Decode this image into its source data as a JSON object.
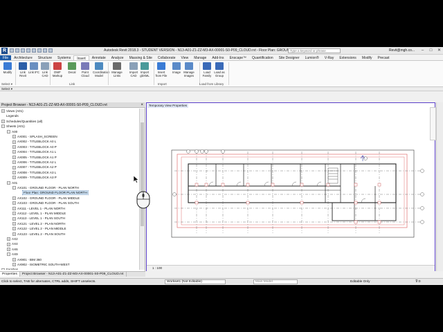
{
  "app": {
    "title": "Autodesk Revit 2018.3 - STUDENT VERSION -    N13-A01-Z1-ZZ-M3-AX-00001-S0-P09_CLOUD.rvt - Floor Plan: GROUND FLOOR PLAN NORTH",
    "search_placeholder": "Type a keyword or phrase",
    "user": "Revit@mgh.co...",
    "window_controls": [
      "–",
      "□",
      "✕"
    ]
  },
  "ribbon_tabs": [
    "File",
    "Architecture",
    "Structure",
    "Systems",
    "Insert",
    "Annotate",
    "Analyze",
    "Massing & Site",
    "Collaborate",
    "View",
    "Manage",
    "Add-Ins",
    "Enscape™",
    "Quantification",
    "Site Designer",
    "Lumion®",
    "V-Ray",
    "Extensions",
    "Modify",
    "Precast"
  ],
  "active_tab": "Insert",
  "ribbon_buttons": [
    {
      "label": "Modify",
      "icon": "modify-icon",
      "color": "#3a7bd5"
    },
    {
      "label": "Link Revit",
      "icon": "link-revit-icon",
      "color": "#2c5fa8"
    },
    {
      "label": "Link IFC",
      "icon": "link-ifc-icon",
      "color": "#6a8fc0"
    },
    {
      "label": "Link CAD",
      "icon": "link-cad-icon",
      "color": "#8aa0b8"
    },
    {
      "label": "DWF Markup",
      "icon": "dwf-markup-icon",
      "color": "#c44"
    },
    {
      "label": "Decal",
      "icon": "decal-icon",
      "color": "#5a9a5a"
    },
    {
      "label": "Point Cloud",
      "icon": "point-cloud-icon",
      "color": "#7a7ab8"
    },
    {
      "label": "Coordination Model",
      "icon": "coordination-model-icon",
      "color": "#4d8ac0"
    },
    {
      "label": "Manage Links",
      "icon": "manage-links-icon",
      "color": "#6a6a6a"
    },
    {
      "label": "Import CAD",
      "icon": "import-cad-icon",
      "color": "#8aa0b8"
    },
    {
      "label": "Import gbXML",
      "icon": "import-gbxml-icon",
      "color": "#4a9a9a"
    },
    {
      "label": "Insert from File",
      "icon": "insert-from-file-icon",
      "color": "#3a7bd5"
    },
    {
      "label": "Image",
      "icon": "image-icon",
      "color": "#5a8ac8"
    },
    {
      "label": "Manage Images",
      "icon": "manage-images-icon",
      "color": "#5a8ac8"
    },
    {
      "label": "Load Family",
      "icon": "load-family-icon",
      "color": "#3a6ab8"
    },
    {
      "label": "Load as Group",
      "icon": "load-as-group-icon",
      "color": "#3a6ab8"
    }
  ],
  "ribbon_groups": [
    "Select ▾",
    "Link",
    "Import",
    "Load from Library"
  ],
  "project_browser": {
    "title": "Project Browser - N13-A01-Z1-ZZ-M3-AX-00001-S0-P09_CLOUD.rvt",
    "tree": [
      {
        "label": "Views (A01)",
        "level": 0,
        "toggle": "+"
      },
      {
        "label": "Legends",
        "level": 0,
        "toggle": ""
      },
      {
        "label": "Schedules/Quantities (all)",
        "level": 0,
        "toggle": "+"
      },
      {
        "label": "Sheets (A01)",
        "level": 0,
        "toggle": "−"
      },
      {
        "label": "A00",
        "level": 1,
        "toggle": "−"
      },
      {
        "label": "AX001 - SPLASH_SCREEN",
        "level": 2,
        "toggle": "+"
      },
      {
        "label": "AX002 - TITLEBLOCK A0 L",
        "level": 2,
        "toggle": "+"
      },
      {
        "label": "AX003 - TITLEBLOCK A0 P",
        "level": 2,
        "toggle": "+"
      },
      {
        "label": "AX004 - TITLEBLOCK A1 L",
        "level": 2,
        "toggle": "+"
      },
      {
        "label": "AX005 - TITLEBLOCK A1 P",
        "level": 2,
        "toggle": "+"
      },
      {
        "label": "AX006 - TITLEBLOCK A2 L",
        "level": 2,
        "toggle": "+"
      },
      {
        "label": "AX007 - TITLEBLOCK A2 P",
        "level": 2,
        "toggle": "+"
      },
      {
        "label": "AX008 - TITLEBLOCK A3 L",
        "level": 2,
        "toggle": "+"
      },
      {
        "label": "AX009 - TITLEBLOCK A3 P",
        "level": 2,
        "toggle": "+"
      },
      {
        "label": "A01",
        "level": 1,
        "toggle": "−"
      },
      {
        "label": "AX101 - GROUND FLOOR - PLAN NORTH",
        "level": 2,
        "toggle": "−"
      },
      {
        "label": "Floor Plan: GROUND FLOOR PLAN NORTH",
        "level": 3,
        "toggle": "",
        "selected": true
      },
      {
        "label": "AX102 - GROUND FLOOR - PLAN MIDDLE",
        "level": 2,
        "toggle": "+"
      },
      {
        "label": "AX103 - GROUND FLOOR - PLAN SOUTH",
        "level": 2,
        "toggle": "+"
      },
      {
        "label": "AX111 - LEVEL 1 - PLAN NORTH",
        "level": 2,
        "toggle": "+"
      },
      {
        "label": "AX112 - LEVEL 1 - PLAN MIDDLE",
        "level": 2,
        "toggle": "+"
      },
      {
        "label": "AX113 - LEVEL 1 - PLAN SOUTH",
        "level": 2,
        "toggle": "+"
      },
      {
        "label": "AX121 - LEVEL 2 - PLAN NORTH",
        "level": 2,
        "toggle": "+"
      },
      {
        "label": "AX122 - LEVEL 2 - PLAN MIDDLE",
        "level": 2,
        "toggle": "+"
      },
      {
        "label": "AX123 - LEVEL 2 - PLAN SOUTH",
        "level": 2,
        "toggle": "+"
      },
      {
        "label": "AX2",
        "level": 1,
        "toggle": "+"
      },
      {
        "label": "AX4",
        "level": 1,
        "toggle": "+"
      },
      {
        "label": "AX6",
        "level": 1,
        "toggle": "+"
      },
      {
        "label": "AX9",
        "level": 1,
        "toggle": "−"
      },
      {
        "label": "AX901 - BIM 360",
        "level": 2,
        "toggle": "+"
      },
      {
        "label": "AX902 - ISOMETRIC SOUTH-WEST",
        "level": 2,
        "toggle": "+"
      },
      {
        "label": "Families",
        "level": 0,
        "toggle": "+"
      }
    ],
    "bottom_tabs": [
      "Properties",
      "Project Browser - N13-A01-Z1-ZZ-M3-AX-00001-S0-P09_CLOUD.rvt"
    ]
  },
  "view": {
    "label": "Temporary View Properties",
    "scale": "1 : 100"
  },
  "status_bar": {
    "text": "Click to select, TAB for alternates, CTRL adds, SHIFT unselects.",
    "workset": "Workset1 (Not Editable)",
    "main_model": "Main Model",
    "editable_only": "Editable Only",
    "filter": "⊽:0"
  },
  "colors": {
    "accent": "#1c5aa6",
    "view_border": "#5a3ec8",
    "plan_red": "#e07070",
    "plan_dark": "#222222"
  }
}
